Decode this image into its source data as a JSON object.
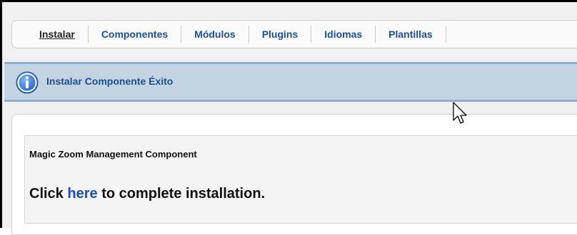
{
  "tabs": [
    {
      "label": "Instalar",
      "active": true
    },
    {
      "label": "Componentes",
      "active": false
    },
    {
      "label": "Módulos",
      "active": false
    },
    {
      "label": "Plugins",
      "active": false
    },
    {
      "label": "Idiomas",
      "active": false
    },
    {
      "label": "Plantillas",
      "active": false
    }
  ],
  "message": {
    "icon": "info-icon",
    "text": "Instalar Componente Éxito",
    "bg_color": "#c4d4e3",
    "text_color": "#1c4f8c"
  },
  "panel": {
    "component_name": "Magic Zoom Management Component",
    "instruction_prefix": "Click",
    "instruction_link": "here",
    "instruction_suffix": "to complete installation."
  },
  "colors": {
    "link": "#1a4fa0",
    "active_tab": "#222222"
  }
}
